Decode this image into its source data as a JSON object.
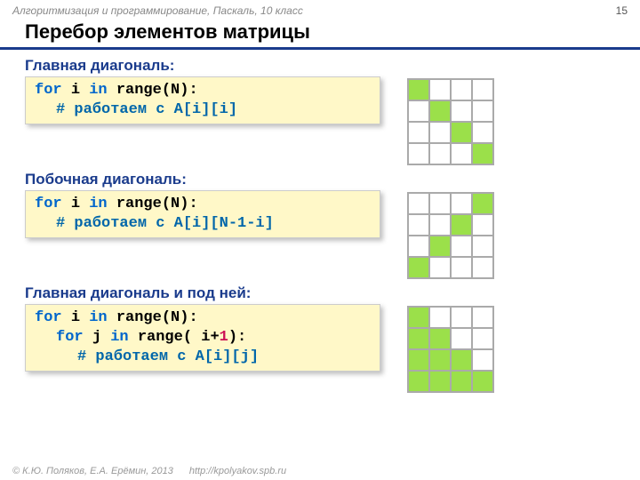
{
  "header": {
    "course": "Алгоритмизация и программирование, Паскаль, 10 класс",
    "page": "15"
  },
  "title": "Перебор элементов матрицы",
  "sections": [
    {
      "label": "Главная диагональ:",
      "code": [
        [
          {
            "cls": "kw-for",
            "t": "for"
          },
          {
            "t": " "
          },
          {
            "cls": "ident",
            "t": "i"
          },
          {
            "t": " "
          },
          {
            "cls": "kw-in",
            "t": "in"
          },
          {
            "t": " "
          },
          {
            "cls": "fn",
            "t": "range"
          },
          {
            "t": "(N):"
          }
        ],
        [
          {
            "cls": "comment",
            "t": "# работаем с A[i][i]"
          }
        ]
      ],
      "indents": [
        0,
        1
      ],
      "grid": "1000,0100,0010,0001"
    },
    {
      "label": "Побочная диагональ:",
      "code": [
        [
          {
            "cls": "kw-for",
            "t": "for"
          },
          {
            "t": " "
          },
          {
            "cls": "ident",
            "t": "i"
          },
          {
            "t": " "
          },
          {
            "cls": "kw-in",
            "t": "in"
          },
          {
            "t": " "
          },
          {
            "cls": "fn",
            "t": "range"
          },
          {
            "t": "(N):"
          }
        ],
        [
          {
            "cls": "comment",
            "t": "# работаем с A[i][N-1-i]"
          }
        ]
      ],
      "indents": [
        0,
        1
      ],
      "grid": "0001,0010,0100,1000"
    },
    {
      "label": "Главная диагональ и под ней:",
      "code": [
        [
          {
            "cls": "kw-for",
            "t": "for"
          },
          {
            "t": " "
          },
          {
            "cls": "ident",
            "t": "i"
          },
          {
            "t": " "
          },
          {
            "cls": "kw-in",
            "t": "in"
          },
          {
            "t": " "
          },
          {
            "cls": "fn",
            "t": "range"
          },
          {
            "t": "(N):"
          }
        ],
        [
          {
            "cls": "kw-for",
            "t": "for"
          },
          {
            "t": " "
          },
          {
            "cls": "ident",
            "t": "j"
          },
          {
            "t": " "
          },
          {
            "cls": "kw-in",
            "t": "in"
          },
          {
            "t": " "
          },
          {
            "cls": "fn",
            "t": "range"
          },
          {
            "t": "( i+"
          },
          {
            "cls": "num",
            "t": "1"
          },
          {
            "t": "):"
          }
        ],
        [
          {
            "cls": "comment",
            "t": "# работаем с A[i][j]"
          }
        ]
      ],
      "indents": [
        0,
        1,
        2
      ],
      "grid": "1000,1100,1110,1111"
    }
  ],
  "footer": {
    "copyright": "© К.Ю. Поляков, Е.А. Ерёмин, 2013",
    "url": "http://kpolyakov.spb.ru"
  }
}
